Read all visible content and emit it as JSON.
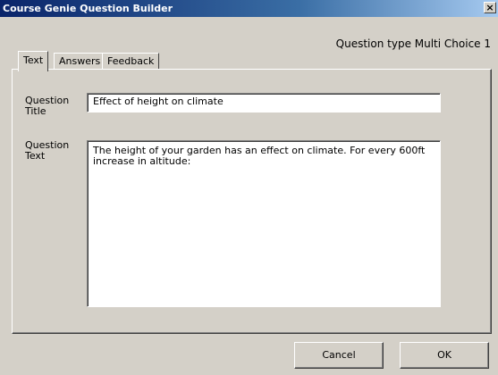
{
  "window": {
    "title": "Course Genie Question Builder",
    "close_glyph": "×"
  },
  "header": {
    "question_type": "Question type Multi Choice 1"
  },
  "tabs": [
    {
      "label": "Text",
      "active": true
    },
    {
      "label": "Answers",
      "active": false
    },
    {
      "label": "Feedback",
      "active": false
    }
  ],
  "form": {
    "title_label": "Question\nTitle",
    "title_value": "Effect of height on climate",
    "text_label": "Question\nText",
    "text_value": "The height of your garden has an effect on climate. For every 600ft increase in altitude:"
  },
  "buttons": {
    "cancel": "Cancel",
    "ok": "OK"
  },
  "colors": {
    "titlebar_start": "#0a246a",
    "titlebar_end": "#a6caf0",
    "dialog_face": "#d4d0c8"
  }
}
